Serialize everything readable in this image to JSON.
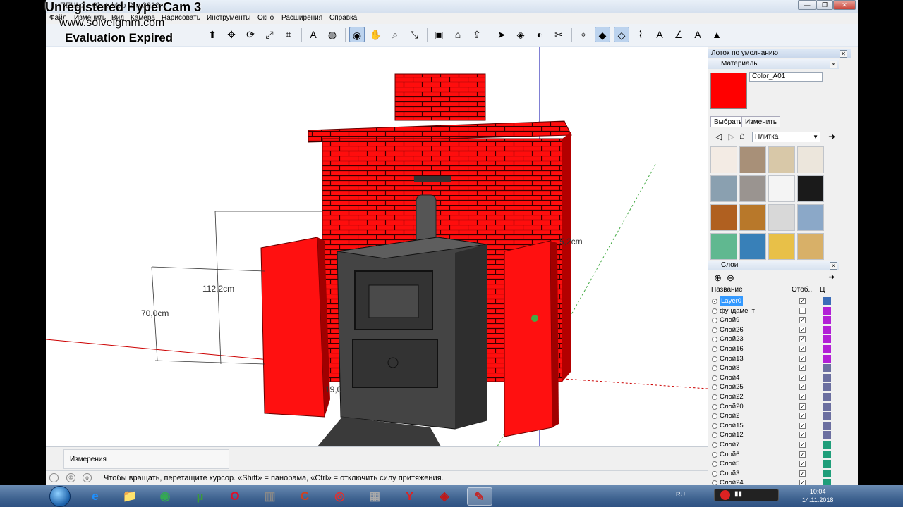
{
  "watermark": {
    "line1": "Unregistered HyperCam 3",
    "line2": "www.solveigmm.com",
    "line3": "Evaluation Expired"
  },
  "window": {
    "title": "ПЕЧЬ2 - SketchUp Pro 2016",
    "min": "—",
    "max": "❐",
    "close": "✕"
  },
  "menu": [
    "Файл",
    "Изменить",
    "Вид",
    "Камера",
    "Нарисовать",
    "Инструменты",
    "Окно",
    "Расширения",
    "Справка"
  ],
  "toolbar_icons": [
    "pencil-icon",
    "eraser-icon",
    "paint-icon",
    "rectangle-icon",
    "push-pull-icon",
    "move-icon",
    "rotate-icon",
    "scale-icon",
    "tape-icon",
    "text-icon",
    "paint-bucket-icon",
    "orbit-icon",
    "pan-icon",
    "zoom-icon",
    "zoom-extents-icon",
    "component-icon",
    "warehouse-icon",
    "share-icon",
    "select-icon",
    "make-component-icon",
    "paint-icon-2",
    "erase-icon-2",
    "axes-icon",
    "iso-view-icon",
    "front-view-icon",
    "tape-measure-icon",
    "dimension-icon",
    "protractor-icon",
    "3d-text-icon",
    "section-icon"
  ],
  "viewport": {
    "dimensions": [
      "112,2cm",
      "70,0cm",
      "5,2cm",
      "19,0"
    ]
  },
  "measurements": {
    "label": "Измерения"
  },
  "status": {
    "text": "Чтобы вращать, перетащите курсор. «Shift» = панорама, «Ctrl» = отключить силу притяжения."
  },
  "tray": {
    "title": "Лоток по умолчанию",
    "materials": {
      "section": "Материалы",
      "current_name": "Color_A01",
      "current_color": "#ff0000",
      "tab_select": "Выбрать",
      "tab_edit": "Изменить",
      "library": "Плитка",
      "textures": [
        "#f3ebe4",
        "#a89078",
        "#d8c8a8",
        "#ece6dc",
        "#8aa0b0",
        "#9a9490",
        "#f4f4f4",
        "#1a1a1a",
        "#b06020",
        "#b8782a",
        "#d8d8d8",
        "#8ba8c8",
        "#60b890",
        "#3880b8",
        "#e8c048",
        "#d8b068"
      ]
    },
    "layers": {
      "section": "Слои",
      "col_name": "Название",
      "col_visible": "Отоб...",
      "col_color": "Ц",
      "rows": [
        {
          "name": "Layer0",
          "visible": true,
          "color": "#3b6cb8",
          "active": true
        },
        {
          "name": "фундамент",
          "visible": false,
          "color": "#b21fd6",
          "active": false
        },
        {
          "name": "Слой9",
          "visible": true,
          "color": "#b21fd6",
          "active": false
        },
        {
          "name": "Слой26",
          "visible": true,
          "color": "#b21fd6",
          "active": false
        },
        {
          "name": "Слой23",
          "visible": true,
          "color": "#b21fd6",
          "active": false
        },
        {
          "name": "Слой16",
          "visible": true,
          "color": "#b21fd6",
          "active": false
        },
        {
          "name": "Слой13",
          "visible": true,
          "color": "#b21fd6",
          "active": false
        },
        {
          "name": "Слой8",
          "visible": true,
          "color": "#6b6fa0",
          "active": false
        },
        {
          "name": "Слой4",
          "visible": true,
          "color": "#6b6fa0",
          "active": false
        },
        {
          "name": "Слой25",
          "visible": true,
          "color": "#6b6fa0",
          "active": false
        },
        {
          "name": "Слой22",
          "visible": true,
          "color": "#6b6fa0",
          "active": false
        },
        {
          "name": "Слой20",
          "visible": true,
          "color": "#6b6fa0",
          "active": false
        },
        {
          "name": "Слой2",
          "visible": true,
          "color": "#6b6fa0",
          "active": false
        },
        {
          "name": "Слой15",
          "visible": true,
          "color": "#6b6fa0",
          "active": false
        },
        {
          "name": "Слой12",
          "visible": true,
          "color": "#6b6fa0",
          "active": false
        },
        {
          "name": "Слой7",
          "visible": true,
          "color": "#1f9e7a",
          "active": false
        },
        {
          "name": "Слой6",
          "visible": true,
          "color": "#1f9e7a",
          "active": false
        },
        {
          "name": "Слой5",
          "visible": true,
          "color": "#1f9e7a",
          "active": false
        },
        {
          "name": "Слой3",
          "visible": true,
          "color": "#1f9e7a",
          "active": false
        },
        {
          "name": "Слой24",
          "visible": true,
          "color": "#1f9e7a",
          "active": false
        }
      ]
    }
  },
  "taskbar": {
    "apps": [
      "ie-icon",
      "explorer-icon",
      "chrome-icon",
      "utorrent-icon",
      "opera-icon",
      "archiver-icon",
      "ccleaner-icon",
      "record-icon",
      "calculator-icon",
      "yandex-icon",
      "app-icon",
      "sketchup-icon"
    ],
    "lang": "RU",
    "time": "10:04",
    "date": "14.11.2018"
  }
}
